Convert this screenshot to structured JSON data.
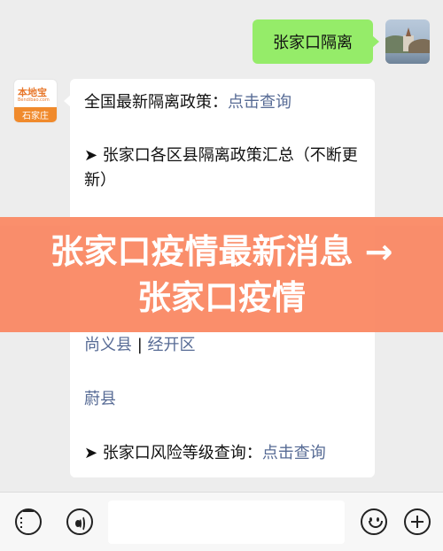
{
  "chat": {
    "outgoing_message": "张家口隔离",
    "incoming": {
      "sender_logo": {
        "top": "本地宝",
        "sub": "Bendibao.com",
        "city": "石家庄"
      },
      "line1_text": "全国最新隔离政策：",
      "line1_link": "点击查询",
      "line2_text": "➤ 张家口各区县隔离政策汇总（不断更新）",
      "link_shangyi": "尚义县",
      "separator": " | ",
      "link_jingkai": "经开区",
      "link_yuxian": "蔚县",
      "line_risk_text": "➤ 张家口风险等级查询：",
      "line_risk_link": "点击查询"
    }
  },
  "overlay": {
    "text": "张家口疫情最新消息 → 张家口疫情"
  },
  "input_bar": {
    "menu_icon": "list-icon",
    "voice_icon": "voice-icon",
    "emoji_icon": "emoji-icon",
    "plus_icon": "plus-icon"
  }
}
